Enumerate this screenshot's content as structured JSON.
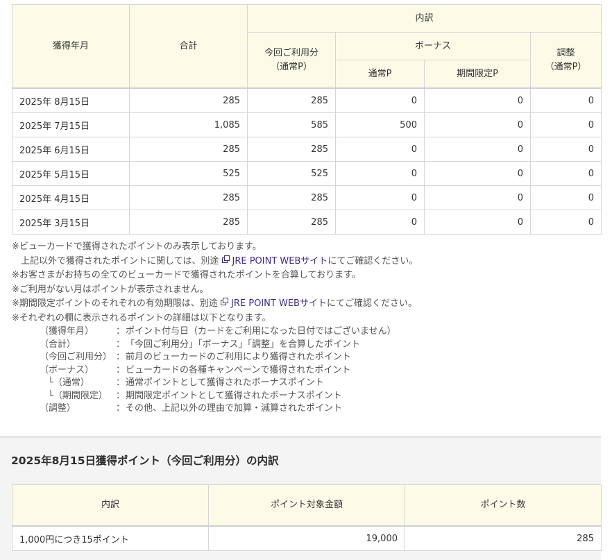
{
  "points_table": {
    "headers": {
      "month": "獲得年月",
      "total": "合計",
      "breakdown": "内訳",
      "usage_line1": "今回ご利用分",
      "usage_line2": "（通常P）",
      "bonus": "ボーナス",
      "adjust_line1": "調整",
      "adjust_line2": "（通常P）",
      "bonus_regular": "通常P",
      "bonus_limited": "期間限定P"
    },
    "rows": [
      {
        "date": "2025年 8月15日",
        "total": "285",
        "usage": "285",
        "bonus_regular": "0",
        "bonus_limited": "0",
        "adjust": "0"
      },
      {
        "date": "2025年 7月15日",
        "total": "1,085",
        "usage": "585",
        "bonus_regular": "500",
        "bonus_limited": "0",
        "adjust": "0"
      },
      {
        "date": "2025年 6月15日",
        "total": "285",
        "usage": "285",
        "bonus_regular": "0",
        "bonus_limited": "0",
        "adjust": "0"
      },
      {
        "date": "2025年 5月15日",
        "total": "525",
        "usage": "525",
        "bonus_regular": "0",
        "bonus_limited": "0",
        "adjust": "0"
      },
      {
        "date": "2025年 4月15日",
        "total": "285",
        "usage": "285",
        "bonus_regular": "0",
        "bonus_limited": "0",
        "adjust": "0"
      },
      {
        "date": "2025年 3月15日",
        "total": "285",
        "usage": "285",
        "bonus_regular": "0",
        "bonus_limited": "0",
        "adjust": "0"
      }
    ]
  },
  "notes": {
    "n1": "※ビューカードで獲得されたポイントのみ表示しております。",
    "n2_prefix": "上記以外で獲得されたポイントに関しては、別途",
    "n2_suffix": "にてご確認ください。",
    "link_text": "JRE POINT WEBサイト",
    "n3": "※お客さまがお持ちの全てのビューカードで獲得されたポイントを合算しております。",
    "n4": "※ご利用がない月はポイントが表示されません。",
    "n5_prefix": "※期間限定ポイントのそれぞれの有効期限は、別途",
    "n5_suffix": "にてご確認ください。",
    "n6": "※それぞれの欄に表示されるポイントの詳細は以下となります。",
    "colon": "：",
    "definitions": [
      {
        "term": "（獲得年月）",
        "desc": "ポイント付与日（カードをご利用になった日付ではございません）"
      },
      {
        "term": "（合計）",
        "desc": "「今回ご利用分」「ボーナス」「調整」を合算したポイント"
      },
      {
        "term": "（今回ご利用分）",
        "desc": "前月のビューカードのご利用により獲得されたポイント"
      },
      {
        "term": "（ボーナス）",
        "desc": "ビューカードの各種キャンペーンで獲得されたポイント"
      },
      {
        "term": "└（通常）",
        "desc": "通常ポイントとして獲得されたボーナスポイント"
      },
      {
        "term": "└（期間限定）",
        "desc": "期間限定ポイントとして獲得されたボーナスポイント"
      },
      {
        "term": "（調整）",
        "desc": "その他、上記以外の理由で加算・減算されたポイント"
      }
    ]
  },
  "breakdown_section": {
    "title": "2025年8月15日獲得ポイント（今回ご利用分）の内訳",
    "headers": {
      "item": "内訳",
      "amount": "ポイント対象金額",
      "points": "ポイント数"
    },
    "rows": [
      {
        "item": "1,000円につき15ポイント",
        "amount": "19,000",
        "points": "285"
      }
    ]
  },
  "colors": {
    "header_bg": "#fdfbe8",
    "border": "#d6d6d6",
    "link": "#3d2d80",
    "section_bg": "#f4f4f4"
  },
  "icons": {
    "external_link": "external-link-icon"
  }
}
